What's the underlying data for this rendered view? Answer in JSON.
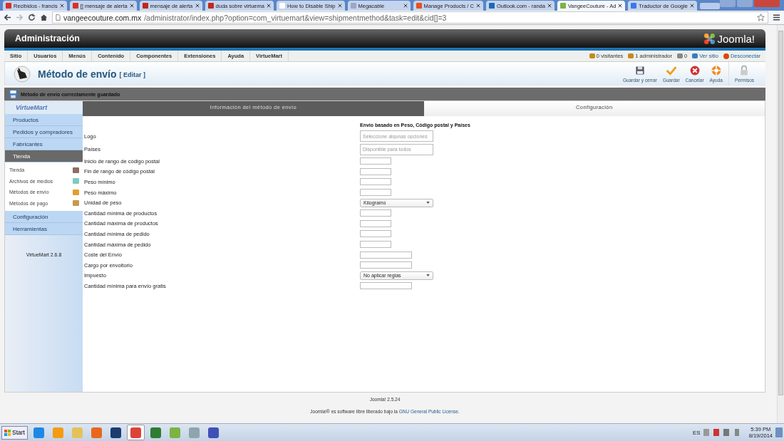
{
  "browser": {
    "tabs": [
      {
        "title": "Recibidos - francis",
        "color": "#d93025",
        "selected": false
      },
      {
        "title": "[] mensaje de alerta",
        "color": "#d93025",
        "selected": false
      },
      {
        "title": "mensaje de alerta",
        "color": "#c2271c",
        "selected": false
      },
      {
        "title": "duda sobre virtuema",
        "color": "#c2271c",
        "selected": false
      },
      {
        "title": "How to Disable Ship",
        "color": "#ffffff",
        "selected": false
      },
      {
        "title": "Megacable",
        "color": "#9aa7c7",
        "selected": false
      },
      {
        "title": "Manage Products / C",
        "color": "#e8501e",
        "selected": false
      },
      {
        "title": "Outlook.com - randa",
        "color": "#1c6ab4",
        "selected": false
      },
      {
        "title": "VangeeCouture - Ad",
        "color": "#7cb342",
        "selected": true
      },
      {
        "title": "Traductor de Google",
        "color": "#3b78e7",
        "selected": false
      }
    ],
    "url_host": "vangeecouture.com.mx",
    "url_path": "/administrator/index.php?option=com_virtuemart&view=shipmentmethod&task=edit&cid[]=3"
  },
  "header": {
    "title": "Administración",
    "logo": "Joomla!"
  },
  "menu": [
    "Sitio",
    "Usuarios",
    "Menús",
    "Contenido",
    "Componentes",
    "Extensiones",
    "Ayuda",
    "VirtueMart"
  ],
  "status": [
    {
      "kind": "users",
      "text": "0 visitantes"
    },
    {
      "kind": "users",
      "text": "1 administrador"
    },
    {
      "kind": "mail",
      "text": "0"
    },
    {
      "kind": "site",
      "text": "Ver sitio"
    },
    {
      "kind": "logout",
      "text": "Desconectar"
    }
  ],
  "page_title": {
    "title": "Método de envío",
    "action": "[ Editar ]"
  },
  "toolbar": [
    {
      "kind": "save",
      "label": "Guardar y cerrar"
    },
    {
      "kind": "check",
      "label": "Guardar"
    },
    {
      "kind": "cancel",
      "label": "Cancelar"
    },
    {
      "kind": "help",
      "label": "Ayuda"
    },
    {
      "kind": "lock",
      "label": "Permisos"
    }
  ],
  "message": "Método de envío correctamente guardado",
  "sidebar": {
    "logo": "VirtueMart",
    "sections": [
      {
        "label": "Productos",
        "selected": false
      },
      {
        "label": "Pedidos y compradores",
        "selected": false
      },
      {
        "label": "Fabricantes",
        "selected": false
      },
      {
        "label": "Tienda",
        "selected": true,
        "children": [
          {
            "label": "Tienda",
            "kind": "shop"
          },
          {
            "label": "Archivos de medios",
            "kind": "media"
          },
          {
            "label": "Métodos de envío",
            "kind": "truck"
          },
          {
            "label": "Métodos de pago",
            "kind": "payment"
          }
        ]
      },
      {
        "label": "Configuración",
        "selected": false
      },
      {
        "label": "Herramientas",
        "selected": false
      }
    ],
    "version": "VirtueMart 2.6.8"
  },
  "content_tabs": [
    {
      "label": "Información del método de envío",
      "selected": false
    },
    {
      "label": "Configuración",
      "selected": true
    }
  ],
  "form": {
    "heading": "Envío basado en Peso, Código postal y Países",
    "fields": [
      {
        "label": "Logo",
        "kind": "multiselect",
        "placeholder": "Seleccione algunas opciones"
      },
      {
        "label": "Países",
        "kind": "multiselect",
        "placeholder": "Disponible para todos"
      },
      {
        "label": "Inicio de rango de código postal",
        "kind": "short"
      },
      {
        "label": "Fin de rango de código postal",
        "kind": "short"
      },
      {
        "label": "Peso mínimo",
        "kind": "short"
      },
      {
        "label": "Peso máximo",
        "kind": "short"
      },
      {
        "label": "Unidad de peso",
        "kind": "select",
        "value": "Kilogramo"
      },
      {
        "label": "Cantidad mínima de productos",
        "kind": "short"
      },
      {
        "label": "Cantidad máxima de productos",
        "kind": "short"
      },
      {
        "label": "Cantidad mínima de pedido",
        "kind": "short"
      },
      {
        "label": "Cantidad máxima de pedido",
        "kind": "short"
      },
      {
        "label": "Coste del Envío",
        "kind": "medium"
      },
      {
        "label": "Cargo por envoltorio",
        "kind": "medium"
      },
      {
        "label": "Impuesto",
        "kind": "select",
        "value": "No aplicar reglas"
      },
      {
        "label": "Cantidad mínima para envío gratis",
        "kind": "medium"
      }
    ]
  },
  "footer": {
    "version": "Joomla! 2.5.24",
    "license_text": "Joomla!® es software libre liberado bajo la",
    "license_link": "GNU General Public License",
    "license_end": "."
  },
  "taskbar": {
    "start": "Start",
    "language": "ES",
    "time": "5:39 PM",
    "date": "8/19/2014"
  }
}
